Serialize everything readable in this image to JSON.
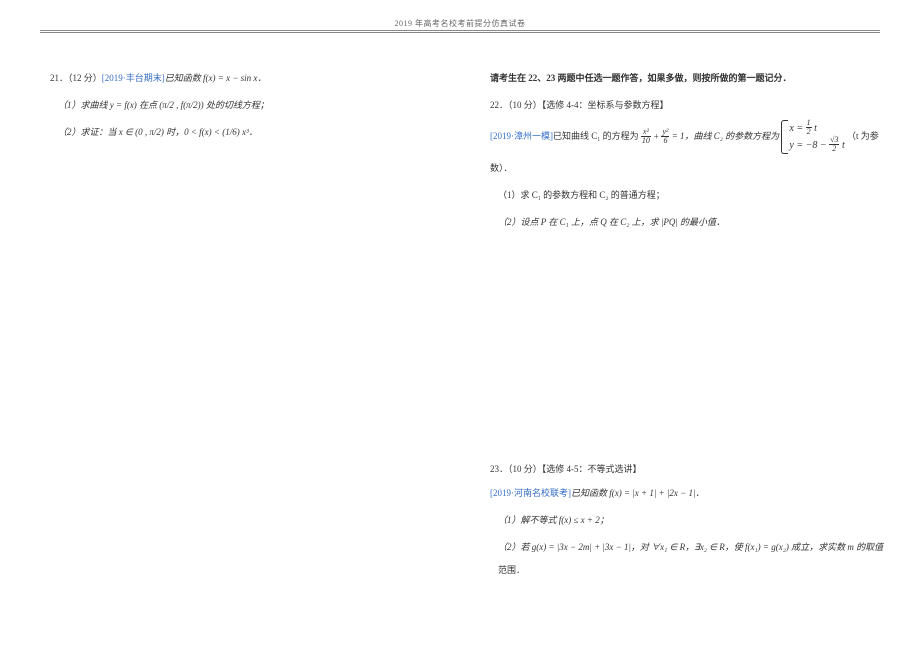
{
  "header": "2019 年高考名校考前提分仿真试卷",
  "left": {
    "q21": {
      "stem_pre": "21．（12 分）",
      "source": "[2019·丰台期末]",
      "stem_post": "已知函数 f(x) = x − sin x．",
      "part1": "（1）求曲线 y = f(x) 在点 (π/2 , f(π/2)) 处的切线方程；",
      "part2": "（2）求证：当 x ∈ (0 , π/2) 时，0 < f(x) < (1/6) x³．"
    }
  },
  "right": {
    "instruction": "请考生在 22、23 两题中任选一题作答，如果多做，则按所做的第一题记分．",
    "q22": {
      "header": "22．（10 分）【选修 4-4：坐标系与参数方程】",
      "source": "[2019·漳州一模]",
      "text1": "已知曲线 C₁ 的方程为",
      "eq1_num_l": "x²",
      "eq1_den_l": "10",
      "eq1_plus": " + ",
      "eq1_num_r": "y²",
      "eq1_den_r": "6",
      "eq1_tail": " = 1，曲线 C₂ 的参数方程为",
      "brace_top_pre": "x = ",
      "brace_top_num": "1",
      "brace_top_den": "2",
      "brace_top_post": " t",
      "brace_bot_pre": "y = −8 − ",
      "brace_bot_num": "√3",
      "brace_bot_den": "2",
      "brace_bot_post": " t",
      "tail": "（t 为参",
      "tail2": "数）．",
      "p1": "（1）求 C₁ 的参数方程和 C₂ 的普通方程；",
      "p2": "（2）设点 P 在 C₁ 上，点 Q 在 C₂ 上，求 |PQ| 的最小值．"
    },
    "q23": {
      "header": "23．（10 分）【选修 4-5：不等式选讲】",
      "source": "[2019·河南名校联考]",
      "text": "已知函数 f(x) = |x + 1| + |2x − 1|．",
      "p1": "（1）解不等式 f(x) ≤ x + 2；",
      "p2": "（2）若 g(x) = |3x − 2m| + |3x − 1|，对 ∀x₁ ∈ R，∃x₂ ∈ R，使 f(x₁) = g(x₂) 成立，求实数 m 的取值",
      "p2b": "范围．"
    }
  }
}
